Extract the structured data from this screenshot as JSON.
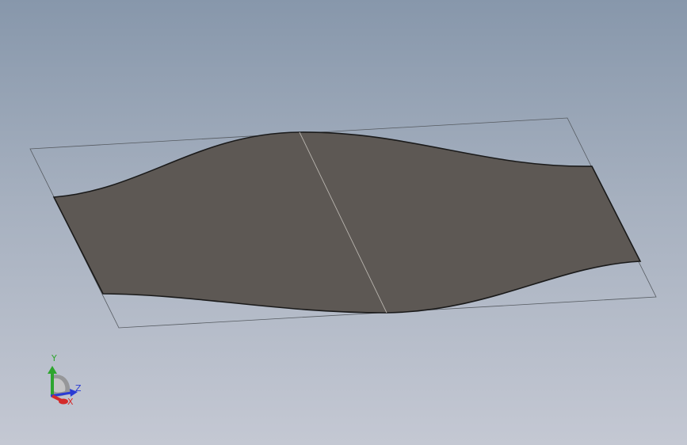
{
  "viewport": {
    "background_top": "#8797ab",
    "background_bottom": "#c4c8d3"
  },
  "model": {
    "surface_color": "#5d5854",
    "edge_color": "#1a1a1a",
    "plane_color": "#555a60",
    "seam_color": "#b8b4ae"
  },
  "triad": {
    "x_label": "X",
    "y_label": "Y",
    "z_label": "Z",
    "x_color": "#d42a2a",
    "y_color": "#2ea52e",
    "z_color": "#2a3bd4"
  }
}
